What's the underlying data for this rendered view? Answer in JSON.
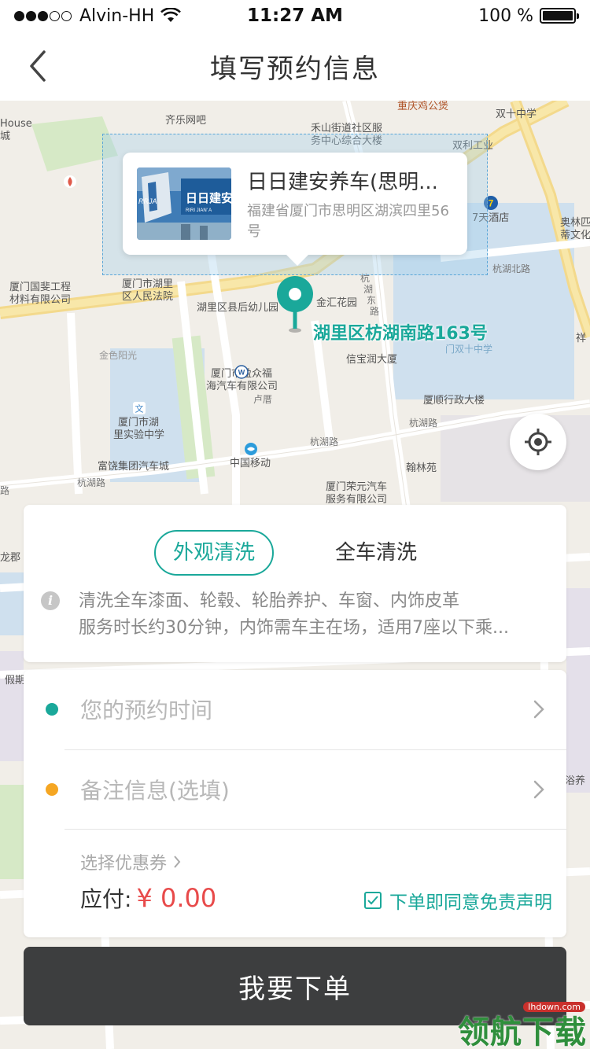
{
  "status_bar": {
    "carrier": "Alvin-HH",
    "time": "11:27 AM",
    "battery": "100 %",
    "signal_bars_filled": 3,
    "signal_bars_total": 5
  },
  "nav": {
    "title": "填写预约信息",
    "back_icon": "chevron-left-icon"
  },
  "map": {
    "labels": [
      "House",
      "城",
      "齐乐网吧",
      "禾山街道社区服",
      "务中心综合大楼",
      "重庆鸡公煲",
      "双十中学",
      "双利工业",
      "7天酒店",
      "奥林匹",
      "蒂文化",
      "厦门国斐工程",
      "材料有限公司",
      "厦门市湖里",
      "区人民法院",
      "湖里区县后幼儿园",
      "金汇花园",
      "杭",
      "湖",
      "东",
      "路",
      "杭湖北路",
      "祥",
      "金色阳光",
      "厦门市盈众福",
      "海汽车有限公司",
      "信宝润大厦",
      "门双十中学",
      "厦顺行政大楼",
      "杭湖路",
      "厦门市湖",
      "里实验中学",
      "卢厝",
      "杭湖路",
      "中国移动",
      "翰林苑",
      "富饶集团汽车城",
      "杭湖路",
      "厦门荣元汽车",
      "服务有限公司",
      "路",
      "龙郡",
      "假期",
      "浴养"
    ],
    "pin_address": "湖里区枋湖南路163号"
  },
  "shop_popup": {
    "name": "日日建安养车(思明...",
    "address": "福建省厦门市思明区湖滨四里56号",
    "thumb_text": "日日建安",
    "thumb_small": "RIRI JIAN' A",
    "thumb_brand": "RRJA"
  },
  "service": {
    "tabs": [
      "外观清洗",
      "全车清洗"
    ],
    "active_tab": 0,
    "desc_line1": "清洗全车漆面、轮毂、轮胎养护、车窗、内饰皮革",
    "desc_line2": "服务时长约30分钟，内饰需车主在场，适用7座以下乘..."
  },
  "form": {
    "time_placeholder": "您的预约时间",
    "note_placeholder": "备注信息(选填)",
    "coupon_label": "选择优惠券",
    "pay_label": "应付:",
    "pay_amount": "¥ 0.00",
    "agree_text": "下单即同意免责声明",
    "agree_checked": true
  },
  "submit": {
    "label": "我要下单"
  },
  "watermark": {
    "site": "lhdown.com",
    "text": "领航下载"
  },
  "colors": {
    "accent": "#1aa89a",
    "price": "#e84a4a",
    "note_dot": "#f5a623",
    "button_bg": "#3d3e3f"
  }
}
